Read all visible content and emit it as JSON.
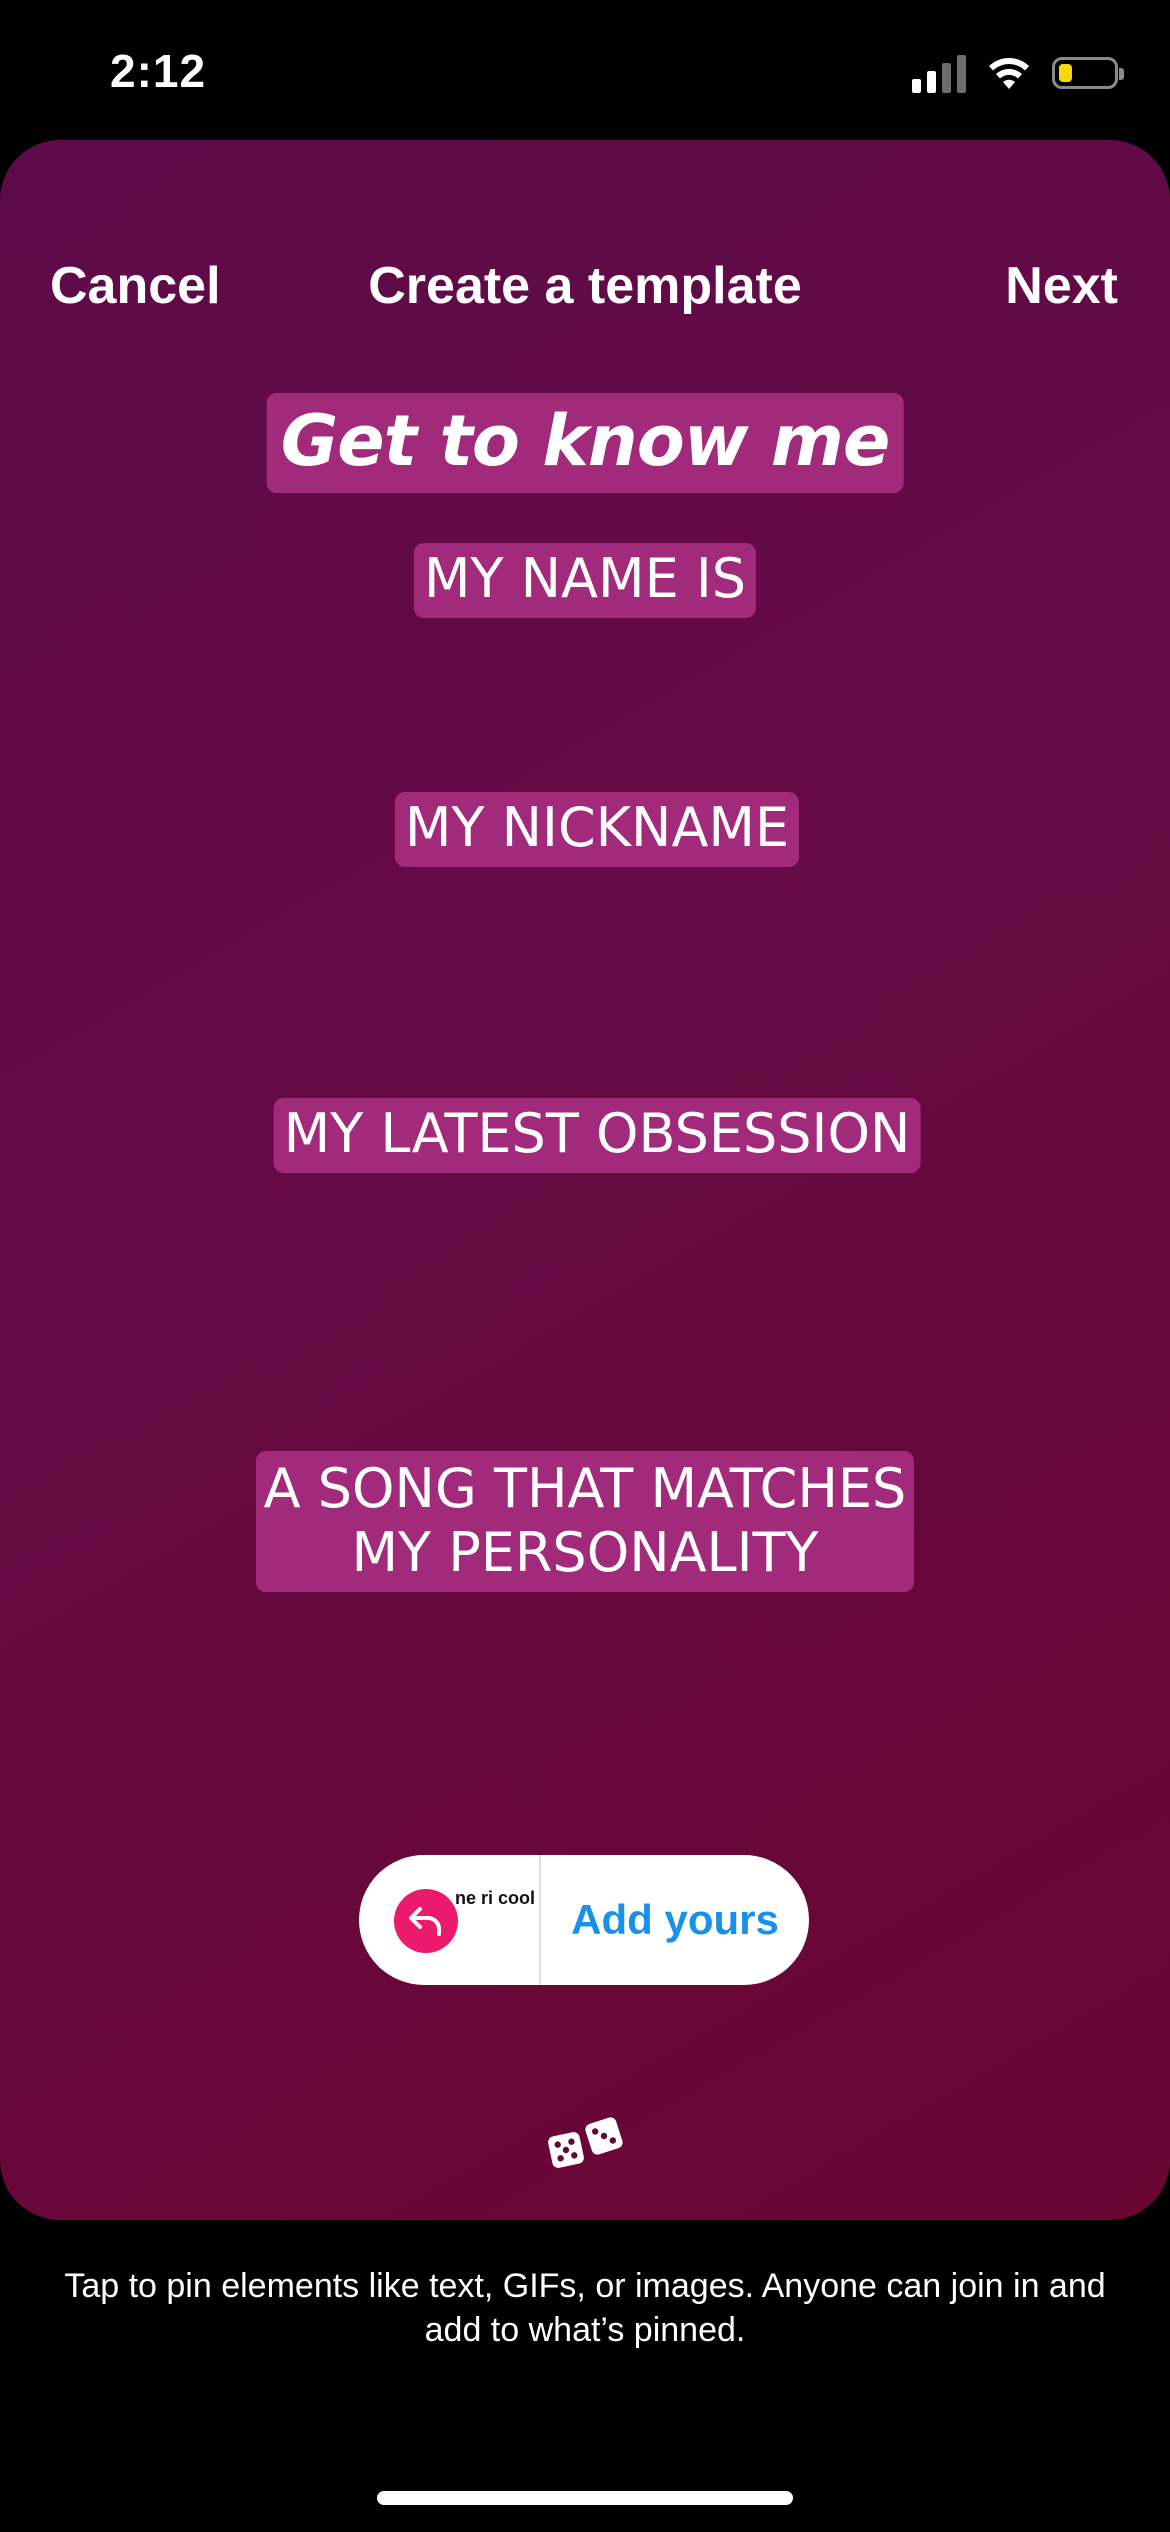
{
  "status_bar": {
    "time": "2:12",
    "signal_bars_active": 2,
    "signal_bars_total": 4,
    "battery_level": 0.25,
    "battery_color": "#f5d90a"
  },
  "nav": {
    "cancel_label": "Cancel",
    "title": "Create a template",
    "next_label": "Next"
  },
  "template": {
    "headline": "Get to know me",
    "prompts": [
      "MY NAME IS",
      "MY NICKNAME",
      "MY LATEST OBSESSION",
      "A SONG THAT MATCHES MY PERSONALITY"
    ],
    "accent_color": "#a22a7a"
  },
  "sticker": {
    "mini_logo_text": "ne ri cool",
    "label": "Add yours",
    "label_color": "#1a91e8",
    "reply_icon_color": "#ec1a6c"
  },
  "dice_icon": "dice-icon",
  "hint": "Tap to pin elements like text, GIFs, or images. Anyone can join in and add to what’s pinned."
}
